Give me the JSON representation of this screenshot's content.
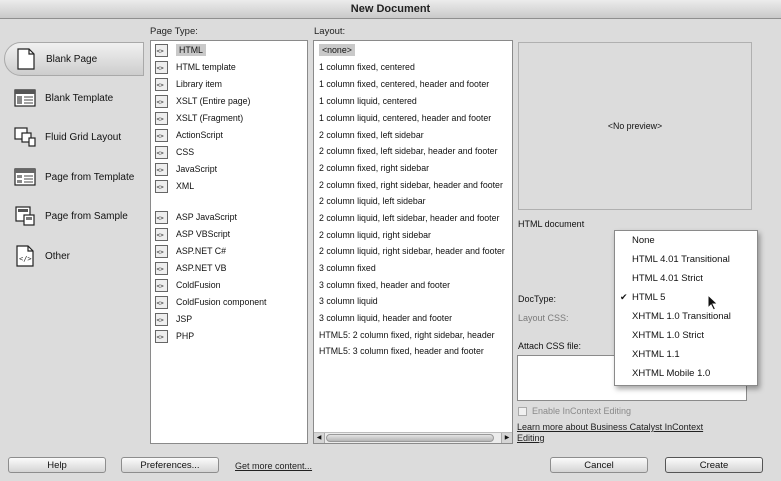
{
  "window": {
    "title": "New Document"
  },
  "sidebar": {
    "items": [
      {
        "label": "Blank Page",
        "icon": "blank-page-icon",
        "selected": true
      },
      {
        "label": "Blank Template",
        "icon": "blank-template-icon",
        "selected": false
      },
      {
        "label": "Fluid Grid Layout",
        "icon": "fluid-grid-icon",
        "selected": false
      },
      {
        "label": "Page from Template",
        "icon": "page-from-template-icon",
        "selected": false
      },
      {
        "label": "Page from Sample",
        "icon": "page-from-sample-icon",
        "selected": false
      },
      {
        "label": "Other",
        "icon": "other-code-icon",
        "selected": false
      }
    ]
  },
  "page_type": {
    "label": "Page Type:",
    "items": [
      {
        "label": "HTML",
        "selected": true
      },
      {
        "label": "HTML template"
      },
      {
        "label": "Library item"
      },
      {
        "label": "XSLT (Entire page)"
      },
      {
        "label": "XSLT (Fragment)"
      },
      {
        "label": "ActionScript"
      },
      {
        "label": "CSS"
      },
      {
        "label": "JavaScript"
      },
      {
        "label": "XML"
      },
      {
        "label": "ASP JavaScript"
      },
      {
        "label": "ASP VBScript"
      },
      {
        "label": "ASP.NET C#"
      },
      {
        "label": "ASP.NET VB"
      },
      {
        "label": "ColdFusion"
      },
      {
        "label": "ColdFusion component"
      },
      {
        "label": "JSP"
      },
      {
        "label": "PHP"
      }
    ]
  },
  "layout": {
    "label": "Layout:",
    "items": [
      {
        "label": "<none>",
        "selected": true
      },
      {
        "label": "1 column fixed, centered"
      },
      {
        "label": "1 column fixed, centered, header and footer"
      },
      {
        "label": "1 column liquid, centered"
      },
      {
        "label": "1 column liquid, centered, header and footer"
      },
      {
        "label": "2 column fixed, left sidebar"
      },
      {
        "label": "2 column fixed, left sidebar, header and footer"
      },
      {
        "label": "2 column fixed, right sidebar"
      },
      {
        "label": "2 column fixed, right sidebar, header and footer"
      },
      {
        "label": "2 column liquid, left sidebar"
      },
      {
        "label": "2 column liquid, left sidebar, header and footer"
      },
      {
        "label": "2 column liquid, right sidebar"
      },
      {
        "label": "2 column liquid, right sidebar, header and footer"
      },
      {
        "label": "3 column fixed"
      },
      {
        "label": "3 column fixed, header and footer"
      },
      {
        "label": "3 column liquid"
      },
      {
        "label": "3 column liquid, header and footer"
      },
      {
        "label": "HTML5: 2 column fixed, right sidebar, header"
      },
      {
        "label": "HTML5: 3 column fixed, header and footer"
      }
    ]
  },
  "preview": {
    "text": "<No preview>"
  },
  "details": {
    "description": "HTML document",
    "doctype_label": "DocType:",
    "layout_css_label": "Layout CSS:",
    "attach_css_label": "Attach CSS file:",
    "incontext_label": "Enable InContext Editing",
    "incontext_checked": false,
    "learn_more": "Learn more about Business Catalyst InContext Editing",
    "learn_more_line1": "Learn more about Business Catalyst InContext",
    "learn_more_line2": "Editing"
  },
  "doctype_menu": {
    "items": [
      {
        "label": "None"
      },
      {
        "label": "HTML 4.01 Transitional"
      },
      {
        "label": "HTML 4.01 Strict"
      },
      {
        "label": "HTML 5",
        "checked": true
      },
      {
        "label": "XHTML 1.0 Transitional"
      },
      {
        "label": "XHTML 1.0 Strict"
      },
      {
        "label": "XHTML 1.1"
      },
      {
        "label": "XHTML Mobile 1.0"
      }
    ]
  },
  "footer": {
    "help": "Help",
    "preferences": "Preferences...",
    "get_more": "Get more content...",
    "cancel": "Cancel",
    "create": "Create"
  }
}
